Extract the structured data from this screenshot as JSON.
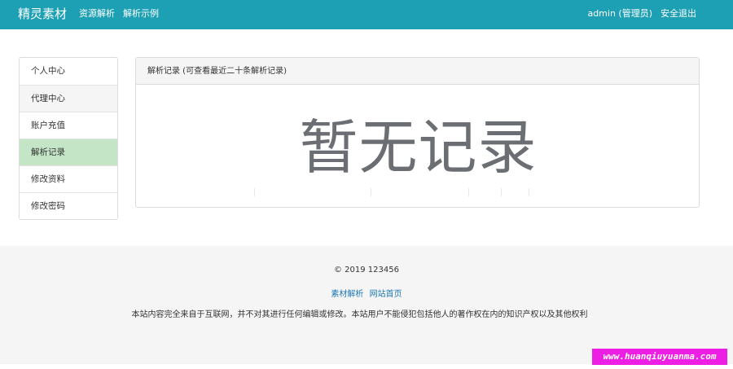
{
  "navbar": {
    "brand": "精灵素材",
    "links": [
      "资源解析",
      "解析示例"
    ],
    "user": "admin (管理员)",
    "logout": "安全退出"
  },
  "sidebar": {
    "items": [
      {
        "label": "个人中心"
      },
      {
        "label": "代理中心"
      },
      {
        "label": "账户充值"
      },
      {
        "label": "解析记录"
      },
      {
        "label": "修改资料"
      },
      {
        "label": "修改密码"
      }
    ],
    "active": "解析记录"
  },
  "panel": {
    "heading": "解析记录 (可查看最近二十条解析记录)",
    "empty_text": "暂无记录"
  },
  "footer": {
    "copyright": "© 2019 123456",
    "links": [
      "素材解析",
      "网站首页"
    ],
    "disclaimer": "本站内容完全来自于互联网，并不对其进行任何编辑或修改。本站用户不能侵犯包括他人的著作权在内的知识产权以及其他权利"
  },
  "watermark": "www.huanqiuyuanma.com",
  "colors": {
    "navbar": "#1ea0b4",
    "active_item": "#c4e6c6",
    "link": "#1e78b4",
    "watermark_bg": "#ee1fe4"
  }
}
